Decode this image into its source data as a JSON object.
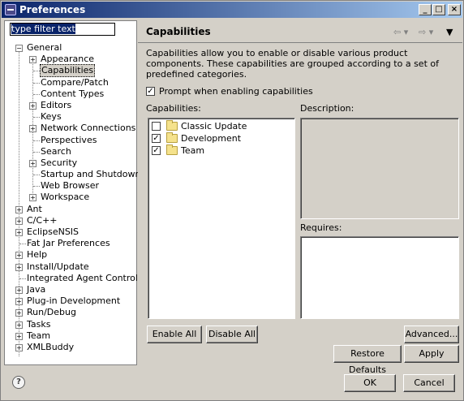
{
  "window": {
    "title": "Preferences",
    "min_glyph": "_",
    "max_glyph": "□",
    "close_glyph": "×"
  },
  "filter": {
    "value": "type filter text"
  },
  "tree": {
    "general": "General",
    "general_children": [
      "Appearance",
      "Capabilities",
      "Compare/Patch",
      "Content Types",
      "Editors",
      "Keys",
      "Network Connections",
      "Perspectives",
      "Search",
      "Security",
      "Startup and Shutdown",
      "Web Browser",
      "Workspace"
    ],
    "top_items": [
      "Ant",
      "C/C++",
      "EclipseNSIS",
      "Fat Jar Preferences",
      "Help",
      "Install/Update",
      "Integrated Agent Controller",
      "Java",
      "Plug-in Development",
      "Run/Debug",
      "Tasks",
      "Team",
      "XMLBuddy"
    ]
  },
  "page": {
    "title": "Capabilities",
    "description": "Capabilities allow you to enable or disable various product components.  These capabilities are grouped according to a set of predefined categories.",
    "prompt_label": "Prompt when enabling capabilities",
    "capabilities_label": "Capabilities:",
    "description_label": "Description:",
    "requires_label": "Requires:",
    "capabilities": [
      {
        "label": "Classic Update",
        "checked": false
      },
      {
        "label": "Development",
        "checked": true
      },
      {
        "label": "Team",
        "checked": true
      }
    ],
    "enable_all": "Enable All",
    "disable_all": "Disable All",
    "advanced": "Advanced...",
    "restore_defaults": "Restore Defaults",
    "apply": "Apply"
  },
  "footer": {
    "help_glyph": "?",
    "ok": "OK",
    "cancel": "Cancel"
  },
  "icons": {
    "back": "back-arrow-icon",
    "forward": "forward-arrow-icon",
    "menu": "view-menu-icon"
  }
}
